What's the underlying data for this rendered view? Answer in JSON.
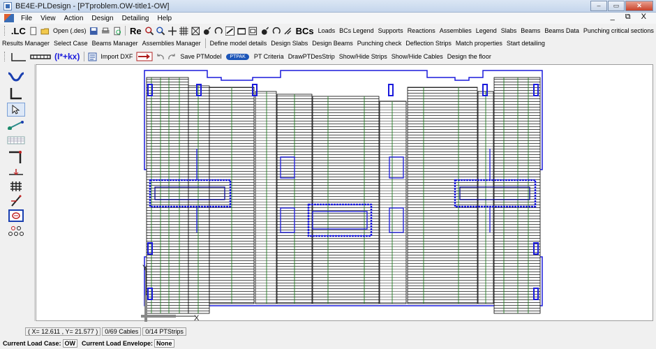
{
  "window": {
    "title": "BE4E-PLDesign - [PTproblem.OW-title1-OW]",
    "buttons": [
      "–",
      "▭",
      "✕"
    ]
  },
  "menu": {
    "items": [
      "File",
      "View",
      "Action",
      "Design",
      "Detailing",
      "Help"
    ],
    "mdi_controls": "_ ⧉ X"
  },
  "toolbar1": {
    "lc": ".LC",
    "open": "Open (.des)",
    "re": "Re",
    "bcs": "BCs",
    "items": [
      "Loads",
      "BCs Legend",
      "Supports",
      "Reactions",
      "Assemblies",
      "Legend",
      "Slabs",
      "Beams",
      "Beams Data",
      "Punching critical sections"
    ]
  },
  "toolbar2": {
    "items": [
      "Results Manager",
      "Select Case",
      "Beams Manager",
      "Assemblies Manager",
      "Define model details",
      "Design Slabs",
      "Design Beams",
      "Punching check",
      "Deflection Strips",
      "Match properties",
      "Start detailing"
    ]
  },
  "toolbar3": {
    "formula": "(I*+kx)",
    "import": "Import DXF",
    "save": "Save PTModel",
    "ptpak": "PTPAK",
    "items": [
      "PT Criteria",
      "DrawPTDesStrip",
      "Show/Hide Strips",
      "Show/Hide Cables",
      "Design the floor"
    ]
  },
  "canvas": {
    "axis_y": "Y",
    "axis_x": "X"
  },
  "status": {
    "coords": "( X= 12.611 , Y= 21.577 )",
    "cables": "0/69 Cables",
    "strips": "0/14 PTStrips"
  },
  "load": {
    "case_label": "Current Load Case:",
    "case_value": "OW",
    "envelope_label": "Current Load Envelope:",
    "envelope_value": "None"
  },
  "colors": {
    "slab_outline": "#1a1adc",
    "strip_line": "#000000",
    "cable": "#1e7a1e"
  }
}
